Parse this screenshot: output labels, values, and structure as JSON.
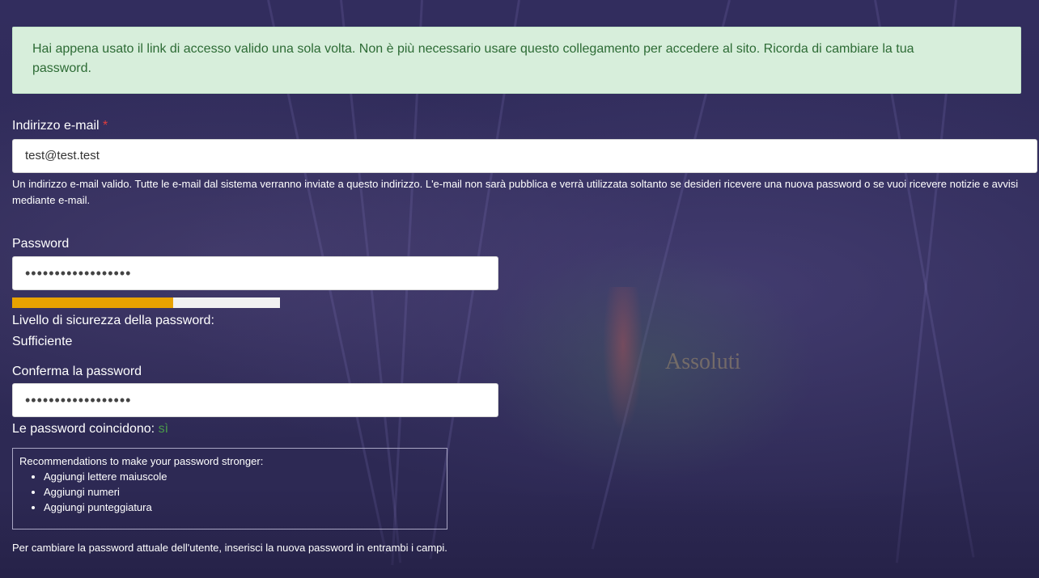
{
  "status": {
    "message": "Hai appena usato il link di accesso valido una sola volta. Non è più necessario usare questo collegamento per accedere al sito. Ricorda di cambiare la tua password."
  },
  "email": {
    "label": "Indirizzo e-mail",
    "required_marker": "*",
    "value": "test@test.test",
    "description": "Un indirizzo e-mail valido. Tutte le e-mail dal sistema verranno inviate a questo indirizzo. L'e-mail non sarà pubblica e verrà utilizzata soltanto se desideri ricevere una nuova password o se vuoi ricevere notizie e avvisi mediante e-mail."
  },
  "password": {
    "label": "Password",
    "value_masked": "••••••••••••••••••",
    "strength_fraction": 0.6,
    "strength_color": "#e8a200",
    "strength_label": "Livello di sicurezza della password:",
    "strength_value": "Sufficiente"
  },
  "confirm": {
    "label": "Conferma la password",
    "value_masked": "••••••••••••••••••",
    "match_label": "Le password coincidono:",
    "match_value": "sì"
  },
  "recommendations": {
    "title": "Recommendations to make your password stronger:",
    "items": [
      "Aggiungi lettere maiuscole",
      "Aggiungi numeri",
      "Aggiungi punteggiatura"
    ]
  },
  "footer": {
    "hint": "Per cambiare la password attuale dell'utente, inserisci la nuova password in entrambi i campi."
  },
  "background": {
    "screen_text": "Assoluti"
  }
}
